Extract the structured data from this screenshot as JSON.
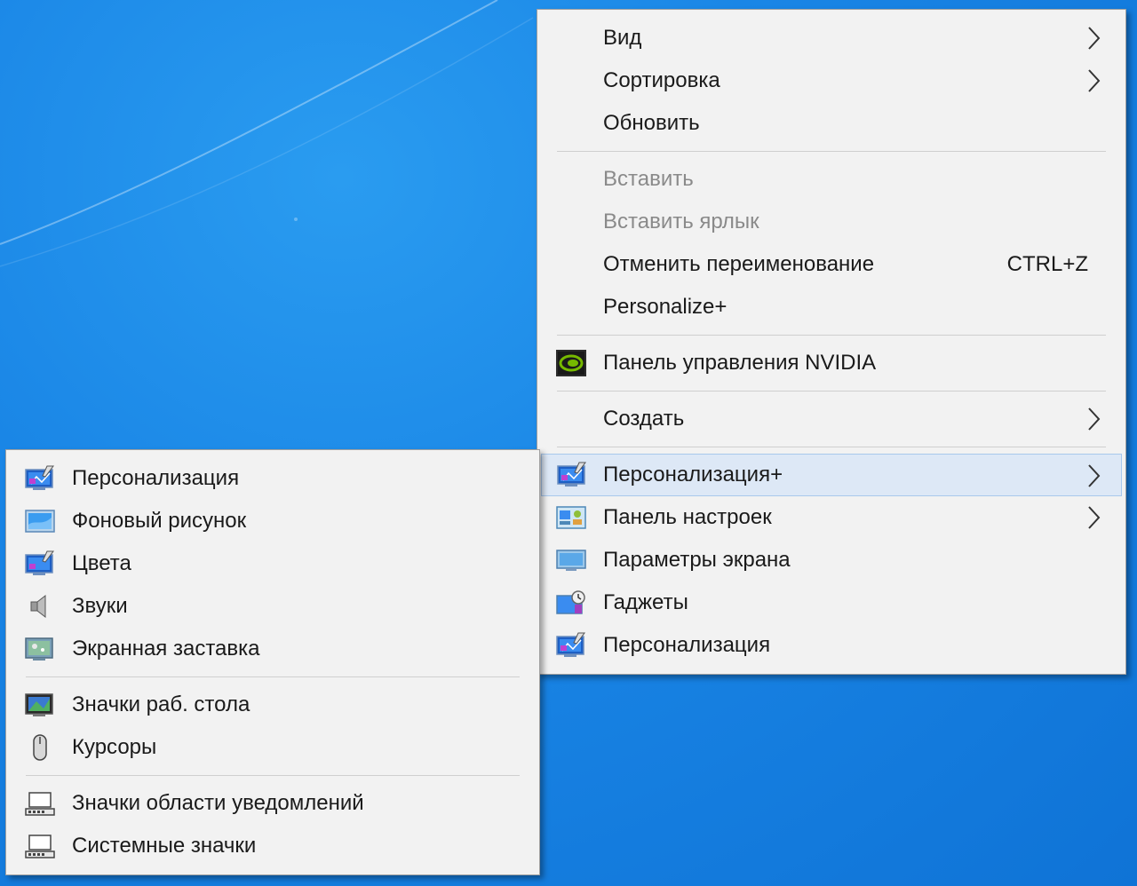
{
  "main_menu": {
    "items": [
      {
        "label": "Вид",
        "has_submenu": true
      },
      {
        "label": "Сортировка",
        "has_submenu": true
      },
      {
        "label": "Обновить"
      },
      {
        "label": "Вставить",
        "disabled": true
      },
      {
        "label": "Вставить ярлык",
        "disabled": true
      },
      {
        "label": "Отменить переименование",
        "shortcut": "CTRL+Z"
      },
      {
        "label": "Personalize+"
      },
      {
        "label": "Панель управления NVIDIA",
        "icon": "nvidia-icon"
      },
      {
        "label": "Создать",
        "has_submenu": true
      },
      {
        "label": "Персонализация+",
        "icon": "personalization-icon",
        "has_submenu": true,
        "highlighted": true
      },
      {
        "label": "Панель настроек",
        "icon": "control-panel-icon",
        "has_submenu": true
      },
      {
        "label": "Параметры экрана",
        "icon": "display-icon"
      },
      {
        "label": "Гаджеты",
        "icon": "gadgets-icon"
      },
      {
        "label": "Персонализация",
        "icon": "personalization-icon"
      }
    ]
  },
  "sub_menu": {
    "items": [
      {
        "label": "Персонализация",
        "icon": "personalization-icon"
      },
      {
        "label": "Фоновый рисунок",
        "icon": "wallpaper-icon"
      },
      {
        "label": "Цвета",
        "icon": "colors-icon"
      },
      {
        "label": "Звуки",
        "icon": "speaker-icon"
      },
      {
        "label": "Экранная заставка",
        "icon": "screensaver-icon"
      },
      {
        "label": "Значки раб. стола",
        "icon": "desktop-icons-icon"
      },
      {
        "label": "Курсоры",
        "icon": "mouse-icon"
      },
      {
        "label": "Значки области уведомлений",
        "icon": "notification-icons-icon"
      },
      {
        "label": "Системные значки",
        "icon": "system-icons-icon"
      }
    ]
  },
  "colors": {
    "desktop": "#1a86e6",
    "menu_bg": "#f2f2f2",
    "highlight_bg": "#dde8f6",
    "disabled_text": "#8a8a8a",
    "nvidia_green": "#76b900"
  }
}
